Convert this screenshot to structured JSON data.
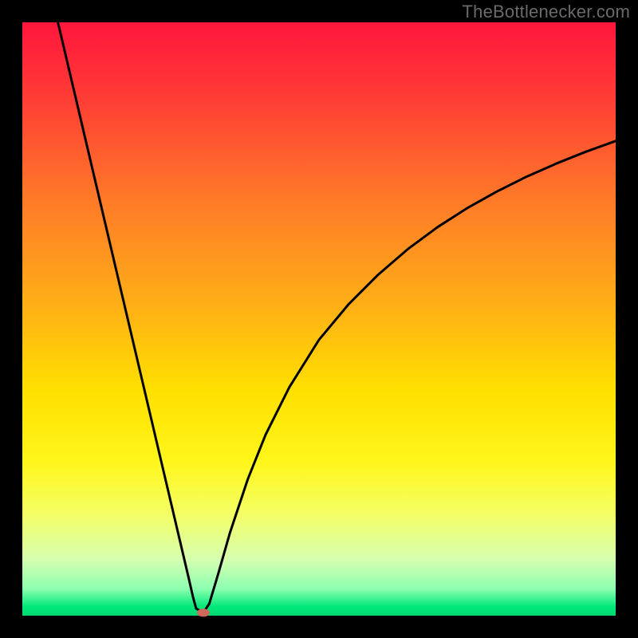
{
  "attribution": "TheBottlenecker.com",
  "chart_data": {
    "type": "line",
    "title": "",
    "xlabel": "",
    "ylabel": "",
    "xlim": [
      0,
      100
    ],
    "ylim": [
      0,
      100
    ],
    "grid": false,
    "legend": false,
    "background": {
      "type": "vertical-gradient",
      "stops": [
        {
          "offset": 0.0,
          "color": "#ff163c"
        },
        {
          "offset": 0.12,
          "color": "#ff3a36"
        },
        {
          "offset": 0.3,
          "color": "#ff7a28"
        },
        {
          "offset": 0.48,
          "color": "#ffb016"
        },
        {
          "offset": 0.62,
          "color": "#ffe000"
        },
        {
          "offset": 0.74,
          "color": "#fff61a"
        },
        {
          "offset": 0.83,
          "color": "#f3ff66"
        },
        {
          "offset": 0.905,
          "color": "#d6ffb0"
        },
        {
          "offset": 0.955,
          "color": "#8cffb0"
        },
        {
          "offset": 0.985,
          "color": "#00e87a"
        },
        {
          "offset": 1.0,
          "color": "#00d870"
        }
      ]
    },
    "series": [
      {
        "name": "curve",
        "color": "#000000",
        "x": [
          6.0,
          8.0,
          10.0,
          12.0,
          14.0,
          16.0,
          18.0,
          20.0,
          22.0,
          24.0,
          26.0,
          28.0,
          28.8,
          29.3,
          30.5,
          31.5,
          33.0,
          35.0,
          38.0,
          41.0,
          45.0,
          50.0,
          55.0,
          60.0,
          65.0,
          70.0,
          75.0,
          80.0,
          85.0,
          90.0,
          95.0,
          100.0
        ],
        "y": [
          100.0,
          91.5,
          83.0,
          74.5,
          66.0,
          57.5,
          49.0,
          40.5,
          32.0,
          23.5,
          15.0,
          6.5,
          3.0,
          1.2,
          0.5,
          2.0,
          7.0,
          14.0,
          23.0,
          30.5,
          38.5,
          46.5,
          52.5,
          57.5,
          61.8,
          65.5,
          68.7,
          71.5,
          74.0,
          76.2,
          78.2,
          80.0
        ]
      }
    ],
    "marker": {
      "x": 30.5,
      "y": 0.5,
      "rx": 8,
      "ry": 5,
      "color": "#cf6a5a"
    },
    "plot_border": {
      "thickness_px": 28,
      "color": "#000000"
    }
  }
}
